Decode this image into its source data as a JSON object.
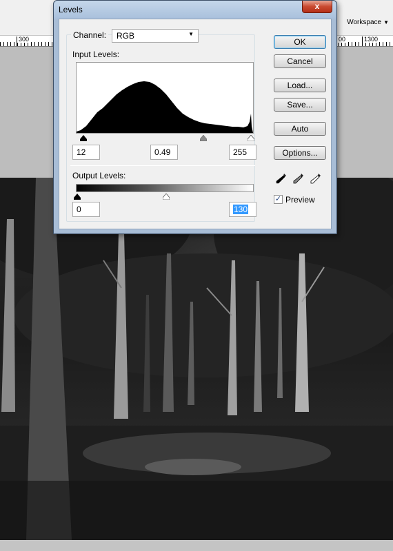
{
  "background_app": {
    "workspace_label": "Workspace",
    "ruler_labels": [
      "300",
      "00",
      "1300"
    ]
  },
  "dialog": {
    "title": "Levels",
    "close_glyph": "x",
    "channel": {
      "label": "Channel:",
      "value": "RGB"
    },
    "input_levels": {
      "label": "Input Levels:",
      "black": "12",
      "gamma": "0.49",
      "white": "255"
    },
    "output_levels": {
      "label": "Output Levels:",
      "black": "0",
      "white": "130"
    },
    "buttons": {
      "ok": "OK",
      "cancel": "Cancel",
      "load": "Load...",
      "save": "Save...",
      "auto": "Auto",
      "options": "Options..."
    },
    "preview": {
      "label": "Preview",
      "checked": true
    },
    "eyedroppers": [
      "black-point-eyedropper-icon",
      "gray-point-eyedropper-icon",
      "white-point-eyedropper-icon"
    ]
  }
}
